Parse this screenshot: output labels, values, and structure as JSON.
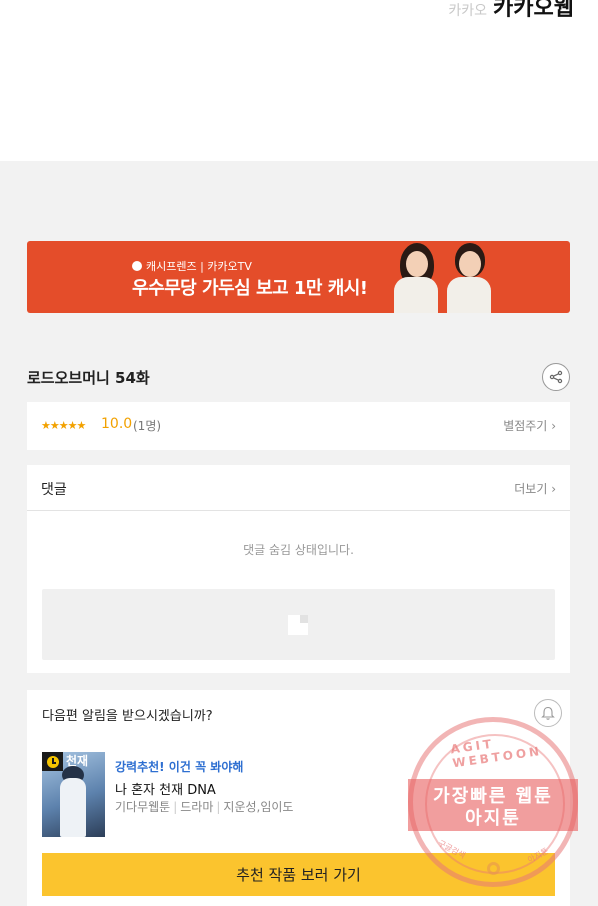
{
  "header": {
    "logo_faint": "카카오",
    "logo_text": "카카오웹"
  },
  "banner": {
    "brand_line": "캐시프렌즈 | 카카오TV",
    "headline": "우수무당 가두심 보고 1만 캐시!"
  },
  "episode": {
    "title": "로드오브머니 54화"
  },
  "rating": {
    "stars": "★★★★★",
    "score": "10.0",
    "count": "(1명)",
    "rate_link": "별점주기"
  },
  "comments": {
    "label": "댓글",
    "more": "더보기",
    "hidden_message": "댓글 숨김 상태입니다."
  },
  "notify": {
    "question": "다음편 알림을 받으시겠습니까?",
    "tag": "강력추천! 이건 꼭 봐야해",
    "rec_title": "나 혼자 천재 DNA",
    "rec_genre1": "기다무웹툰",
    "rec_genre2": "드라마",
    "rec_authors": "지운성,임이도",
    "thumb_text": "천재",
    "button": "추천 작품 보러 가기"
  },
  "stamp": {
    "ring_text": "AGIT WEBTOON",
    "line1": "가장빠른 웹툰",
    "line2": "아지툰",
    "small_left": "구글검색",
    "small_right": "아지툰"
  },
  "colors": {
    "banner_bg": "#e44d2a",
    "star": "#f2a100",
    "tag_blue": "#2e6fd1",
    "cta_yellow": "#fbc42e"
  }
}
